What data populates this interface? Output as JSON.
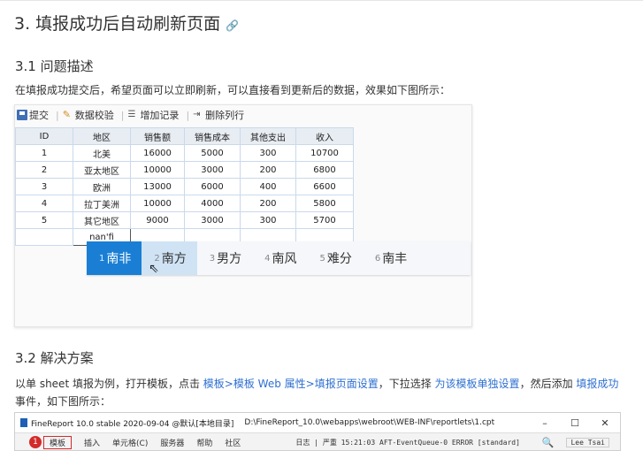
{
  "section3": {
    "title": "3. 填报成功后自动刷新页面",
    "link_icon": "link-icon"
  },
  "s31": {
    "title": "3.1 问题描述",
    "desc": "在填报成功提交后，希望页面可以立即刷新，可以直接看到更新后的数据，效果如下图所示："
  },
  "toolbar": {
    "submit": "提交",
    "validate": "数据校验",
    "add_record": "增加记录",
    "delete_row": "删除列行"
  },
  "table": {
    "headers": [
      "ID",
      "地区",
      "销售额",
      "销售成本",
      "其他支出",
      "收入"
    ],
    "rows": [
      [
        "1",
        "北美",
        "16000",
        "5000",
        "300",
        "10700"
      ],
      [
        "2",
        "亚太地区",
        "10000",
        "3000",
        "200",
        "6800"
      ],
      [
        "3",
        "欧洲",
        "13000",
        "6000",
        "400",
        "6600"
      ],
      [
        "4",
        "拉丁美洲",
        "10000",
        "4000",
        "200",
        "5800"
      ],
      [
        "5",
        "其它地区",
        "9000",
        "3000",
        "300",
        "5700"
      ]
    ],
    "editing_value": "nan'fi"
  },
  "ime": {
    "candidates": [
      {
        "n": "1",
        "text": "南非"
      },
      {
        "n": "2",
        "text": "南方"
      },
      {
        "n": "3",
        "text": "男方"
      },
      {
        "n": "4",
        "text": "南风"
      },
      {
        "n": "5",
        "text": "难分"
      },
      {
        "n": "6",
        "text": "南丰"
      }
    ]
  },
  "s32": {
    "title": "3.2 解决方案",
    "p1": "以单 sheet 填报为例，打开模板，点击",
    "link1": "模板>模板 Web 属性>填报页面设置",
    "p2": "，下拉选择",
    "link2": "为该模板单独设置",
    "p3": "，然后添加",
    "link3": "填报成功",
    "p4": "事件，如下图所示："
  },
  "screenshot2": {
    "app_title": "FineReport 10.0 stable 2020-09-04 @默认[本地目录]",
    "path": "D:\\FineReport_10.0\\webapps\\webroot\\WEB-INF\\reportlets\\1.cpt",
    "badge": "1",
    "menu": [
      "模板",
      "插入",
      "单元格(C)",
      "服务器",
      "帮助",
      "社区"
    ],
    "log": "日志 | 严重 15:21:03 AFT-EventQueue-0 ERROR [standard]",
    "user": "Lee Tsai",
    "win_buttons": [
      "–",
      "☐",
      "✕"
    ]
  }
}
